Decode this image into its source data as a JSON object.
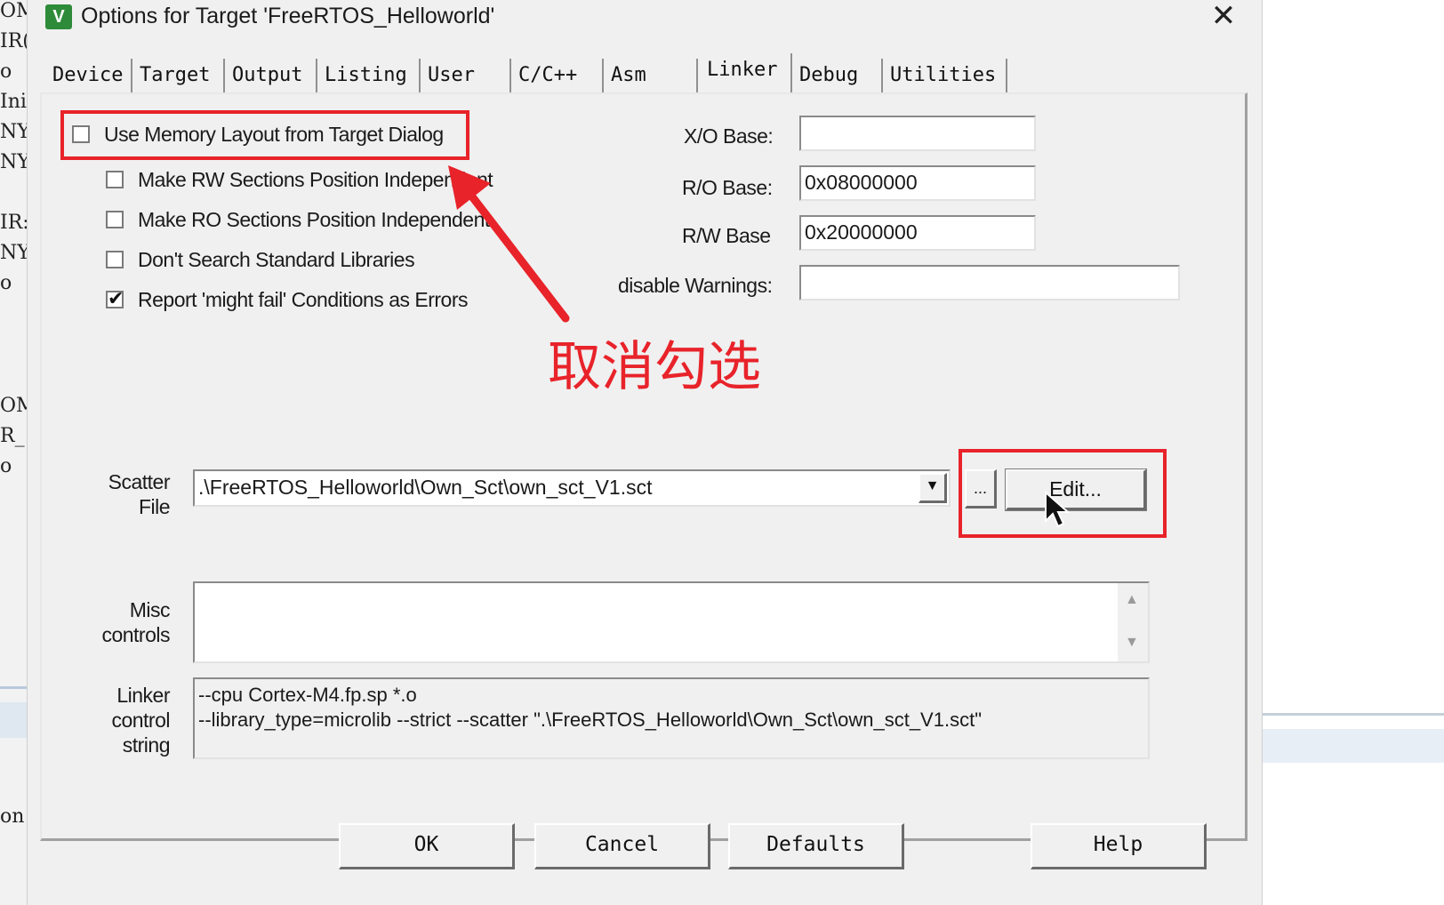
{
  "background": {
    "left_fragments": [
      "OM",
      "IR(",
      "o",
      "Ini",
      "NY",
      "NY",
      "IR:",
      "NY",
      "o",
      "OM:",
      "R_",
      "o",
      "on"
    ]
  },
  "window": {
    "title": "Options for Target 'FreeRTOS_Helloworld'",
    "close_label": "✕",
    "icon": "keil-uvision-icon"
  },
  "tabs": [
    {
      "label": "Device"
    },
    {
      "label": "Target"
    },
    {
      "label": "Output"
    },
    {
      "label": "Listing"
    },
    {
      "label": "User"
    },
    {
      "label": "C/C++"
    },
    {
      "label": "Asm"
    },
    {
      "label": "Linker",
      "active": true
    },
    {
      "label": "Debug"
    },
    {
      "label": "Utilities"
    }
  ],
  "linker": {
    "options": [
      {
        "label": "Use Memory Layout from Target Dialog",
        "checked": false
      },
      {
        "label": "Make RW Sections Position Independent",
        "checked": false
      },
      {
        "label": "Make RO Sections Position Independent",
        "checked": false
      },
      {
        "label": "Don't Search Standard Libraries",
        "checked": false
      },
      {
        "label": "Report 'might fail' Conditions as Errors",
        "checked": true
      }
    ],
    "xo_base_label": "X/O Base:",
    "xo_base_value": "",
    "ro_base_label": "R/O Base:",
    "ro_base_value": "0x08000000",
    "rw_base_label": "R/W Base",
    "rw_base_value": "0x20000000",
    "disable_warnings_label": "disable Warnings:",
    "disable_warnings_value": "",
    "scatter_label_1": "Scatter",
    "scatter_label_2": "File",
    "scatter_value": ".\\FreeRTOS_Helloworld\\Own_Sct\\own_sct_V1.sct",
    "browse_label": "...",
    "edit_label": "Edit...",
    "misc_label_1": "Misc",
    "misc_label_2": "controls",
    "misc_value": "",
    "control_label_1": "Linker",
    "control_label_2": "control",
    "control_label_3": "string",
    "control_line_1": "--cpu Cortex-M4.fp.sp *.o",
    "control_line_2": "--library_type=microlib --strict --scatter \".\\FreeRTOS_Helloworld\\Own_Sct\\own_sct_V1.sct\""
  },
  "annotation": {
    "text": "取消勾选",
    "color": "#e8232a"
  },
  "footer": {
    "ok_label": "OK",
    "cancel_label": "Cancel",
    "defaults_label": "Defaults",
    "help_label": "Help"
  }
}
